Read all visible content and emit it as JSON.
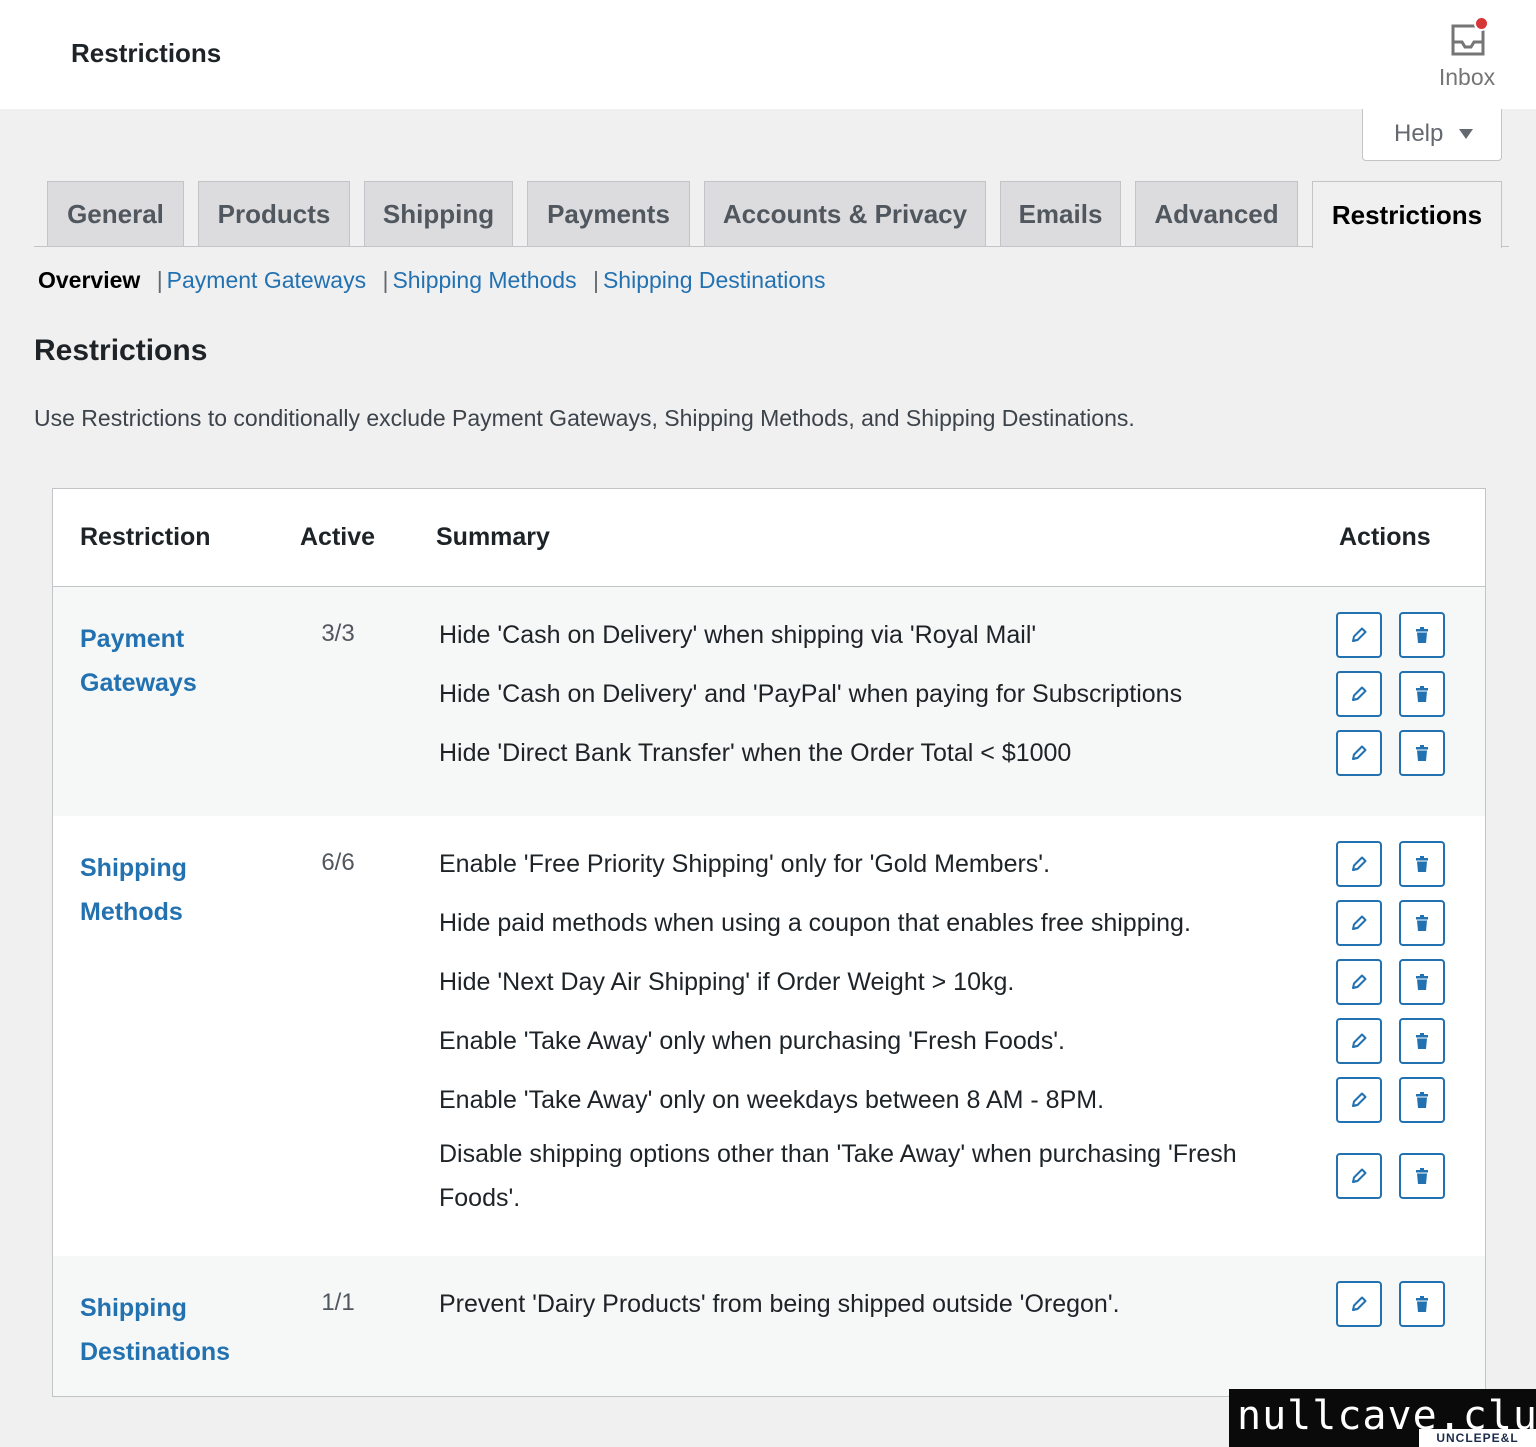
{
  "header": {
    "title": "Restrictions",
    "inbox_label": "Inbox"
  },
  "help": {
    "label": "Help"
  },
  "tabs": [
    {
      "label": "General"
    },
    {
      "label": "Products"
    },
    {
      "label": "Shipping"
    },
    {
      "label": "Payments"
    },
    {
      "label": "Accounts & Privacy"
    },
    {
      "label": "Emails"
    },
    {
      "label": "Advanced"
    },
    {
      "label": "Restrictions",
      "active": true
    }
  ],
  "subnav": {
    "current": "Overview",
    "links": [
      "Payment Gateways",
      "Shipping Methods",
      "Shipping Destinations"
    ],
    "separator": "|"
  },
  "section": {
    "title": "Restrictions",
    "description": "Use Restrictions to conditionally exclude Payment Gateways, Shipping Methods, and Shipping Destinations."
  },
  "table": {
    "columns": [
      "Restriction",
      "Active",
      "Summary",
      "Actions"
    ],
    "groups": [
      {
        "name": "Payment Gateways",
        "active": "3/3",
        "rules": [
          "Hide 'Cash on Delivery' when shipping via 'Royal Mail'",
          "Hide 'Cash on Delivery' and 'PayPal' when paying for Subscriptions",
          "Hide 'Direct Bank Transfer' when the Order Total < $1000"
        ]
      },
      {
        "name": "Shipping Methods",
        "active": "6/6",
        "rules": [
          "Enable 'Free Priority Shipping' only for 'Gold Members'.",
          "Hide paid methods when using a coupon that enables free shipping.",
          "Hide 'Next Day Air Shipping' if Order Weight > 10kg.",
          "Enable 'Take Away' only when purchasing 'Fresh Foods'.",
          "Enable 'Take Away' only on weekdays between 8 AM - 8PM.",
          "Disable shipping options other than 'Take Away' when purchasing 'Fresh Foods'."
        ]
      },
      {
        "name": "Shipping Destinations",
        "active": "1/1",
        "rules": [
          "Prevent 'Dairy Products' from being shipped outside 'Oregon'."
        ]
      }
    ],
    "action_icons": [
      "pencil-icon",
      "trash-icon"
    ]
  },
  "watermark": {
    "main": "nullcave.club",
    "sub": "UNCLEPE&L"
  },
  "colors": {
    "link": "#2271b1",
    "background": "#f0f0f1",
    "notification": "#d63638"
  }
}
